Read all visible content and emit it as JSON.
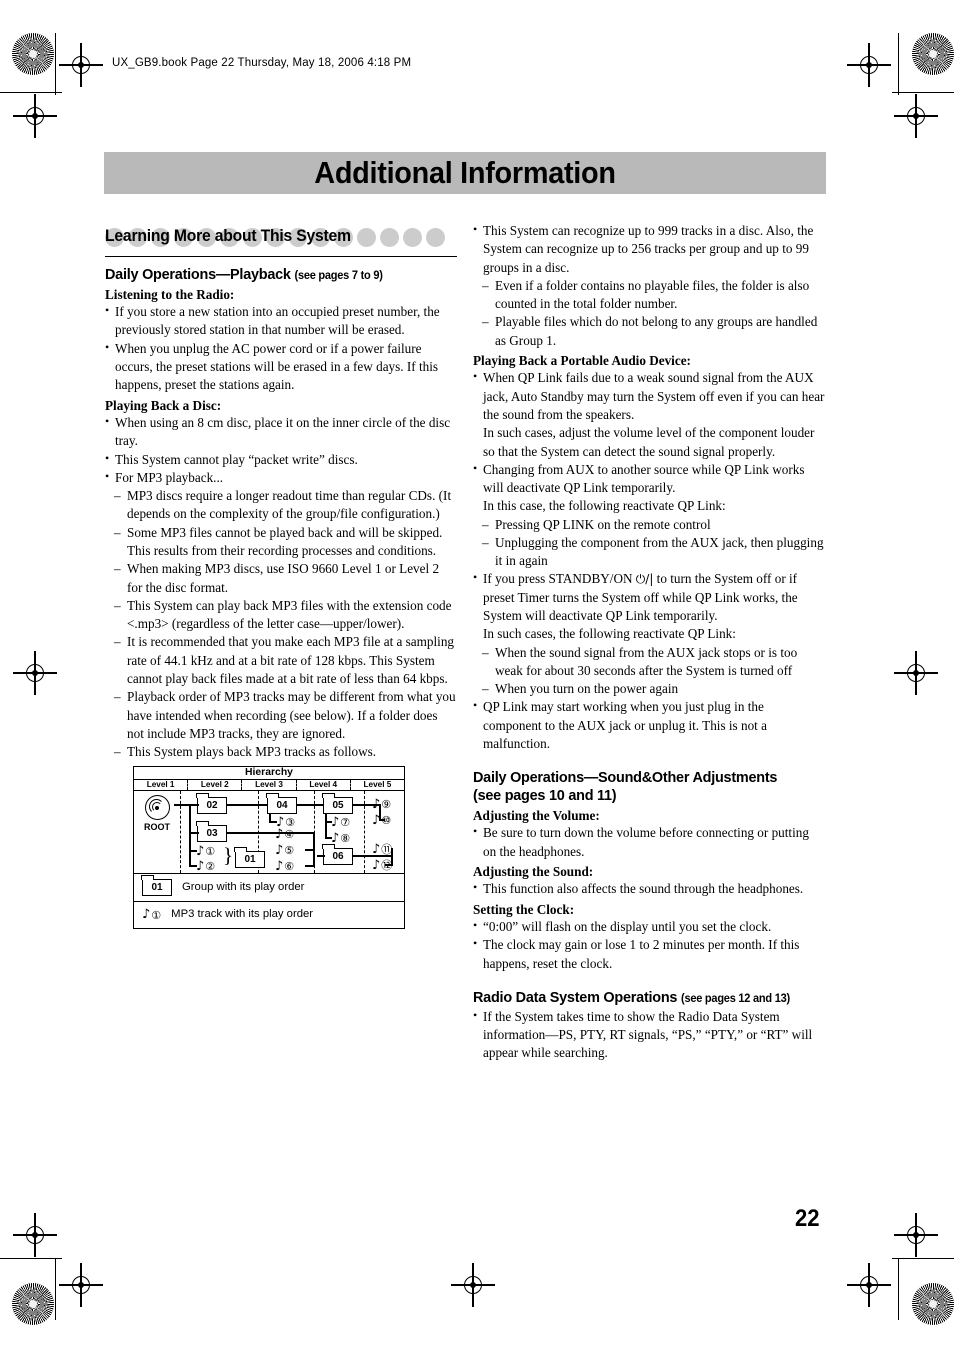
{
  "slug": "UX_GB9.book  Page 22  Thursday, May 18, 2006  4:18 PM",
  "banner": {
    "title": "Additional Information"
  },
  "page_number": "22",
  "colors": {
    "banner_gray": "#b9b9b9",
    "circle_gray": "#cccccc"
  },
  "section": {
    "title": "Learning More about This System"
  },
  "left": {
    "h_playback": "Daily Operations—Playback",
    "h_playback_pages": "(see pages 7 to 9)",
    "sub_radio": "Listening to the Radio:",
    "radio_items": [
      "If you store a new station into an occupied preset number, the previously stored station in that number will be erased.",
      "When you unplug the AC power cord or if a power failure occurs, the preset stations will be erased in a few days. If this happens, preset the stations again."
    ],
    "sub_disc": "Playing Back a Disc:",
    "disc_items": [
      "When using an 8 cm disc, place it on the inner circle of the disc tray.",
      "This System cannot play “packet write” discs."
    ],
    "mp3_lead": "For MP3 playback...",
    "mp3_items": [
      "MP3 discs require a longer readout time than regular CDs. (It depends on the complexity of the group/file configuration.)",
      "Some MP3 files cannot be played back and will be skipped. This results from their recording processes and conditions.",
      "When making MP3 discs, use ISO 9660 Level 1 or Level 2 for the disc format.",
      "This System can play back MP3 files with the extension code <.mp3> (regardless of the letter case—upper/lower).",
      "It is recommended that you make each MP3 file at a sampling rate of 44.1 kHz and at a bit rate of 128 kbps. This System cannot play back files made at a bit rate of less than 64 kbps.",
      "Playback order of MP3 tracks may be different from what you have intended when recording (see below). If a folder does not include MP3 tracks, they are ignored.",
      "This System plays back MP3 tracks as follows."
    ]
  },
  "figure": {
    "title": "Hierarchy",
    "levels": [
      "Level 1",
      "Level 2",
      "Level 3",
      "Level 4",
      "Level 5"
    ],
    "root_label": "ROOT",
    "groups": [
      "02",
      "03",
      "01",
      "04",
      "05",
      "06"
    ],
    "tracks": [
      "①",
      "②",
      "③",
      "④",
      "⑤",
      "⑥",
      "⑦",
      "⑧",
      "⑨",
      "⑩",
      "⑪",
      "⑫"
    ],
    "legend": [
      {
        "sample": "01",
        "text": "Group with its play order"
      },
      {
        "sample": "①",
        "text": "MP3 track with its play order"
      }
    ]
  },
  "right": {
    "disc_limits": "This System can recognize up to 999 tracks in a disc. Also, the System can recognize up to 256 tracks per group and up to 99 groups in a disc.",
    "disc_limit_subs": [
      "Even if a folder contains no playable files, the folder is also counted in the total folder number.",
      "Playable files which do not belong to any groups are handled as Group 1."
    ],
    "sub_portable": "Playing Back a Portable Audio Device:",
    "qp1": "When QP Link fails due to a weak sound signal from the AUX jack, Auto Standby may turn the System off even if you can hear the sound from the speakers.",
    "qp1b": "In such cases, adjust the volume level of the component louder so that the System can detect the sound signal properly.",
    "qp2": "Changing from AUX to another source while QP Link works will deactivate QP Link temporarily.",
    "qp2b": "In this case, the following reactivate QP Link:",
    "qp2subs": [
      "Pressing QP LINK on the remote control",
      "Unplugging the component from the AUX jack, then plugging it in again"
    ],
    "qp3_pre": "If you press STANDBY/ON ",
    "qp3_icon": "⏻/|",
    "qp3_post": " to turn the System off or if preset Timer turns the System off while QP Link works, the System will deactivate QP Link temporarily.",
    "qp3b": "In such cases, the following reactivate QP Link:",
    "qp3subs": [
      "When the sound signal from the AUX jack stops or is too weak for about 30 seconds after the System is turned off",
      "When you turn on the power again"
    ],
    "qp4": "QP Link may start working when you just plug in the component to the AUX jack or unplug it. This is not a malfunction.",
    "h_sound": "Daily Operations—Sound&Other Adjustments",
    "h_sound_pages": "(see pages 10 and 11)",
    "sub_volume": "Adjusting the Volume:",
    "volume_item": "Be sure to turn down the volume before connecting or putting on the headphones.",
    "sub_sound": "Adjusting the Sound:",
    "sound_item": "This function also affects the sound through the headphones.",
    "sub_clock": "Setting the Clock:",
    "clock_items": [
      "“0:00” will flash on the display until you set the clock.",
      "The clock may gain or lose 1 to 2 minutes per month. If this happens, reset the clock."
    ],
    "h_rds": "Radio Data System Operations",
    "h_rds_pages": "(see pages 12 and 13)",
    "rds_item": "If the System takes time to show the Radio Data System information—PS, PTY, RT signals, “PS,” “PTY,” or “RT” will appear while searching."
  }
}
